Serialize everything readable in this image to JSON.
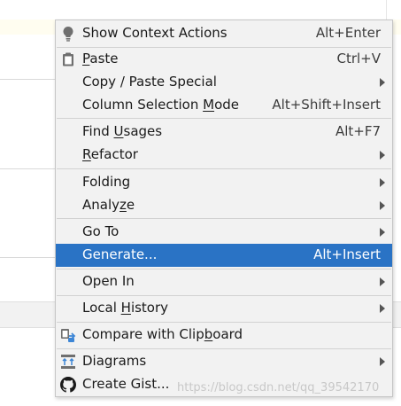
{
  "menu": {
    "items": [
      {
        "name": "show-context-actions",
        "icon": "lightbulb-icon",
        "label": "Show Context Actions",
        "shortcut": "Alt+Enter"
      },
      {
        "name": "paste",
        "icon": "clipboard-icon",
        "label_pre": "",
        "label_u": "P",
        "label_post": "aste",
        "shortcut": "Ctrl+V"
      },
      {
        "name": "copy-paste-special",
        "label": "Copy / Paste Special",
        "submenu": true
      },
      {
        "name": "column-selection-mode",
        "label_pre": "Column Selection ",
        "label_u": "M",
        "label_post": "ode",
        "shortcut": "Alt+Shift+Insert"
      },
      {
        "name": "find-usages",
        "label_pre": "Find ",
        "label_u": "U",
        "label_post": "sages",
        "shortcut": "Alt+F7"
      },
      {
        "name": "refactor",
        "label_pre": "",
        "label_u": "R",
        "label_post": "efactor",
        "submenu": true
      },
      {
        "name": "folding",
        "label": "Folding",
        "submenu": true
      },
      {
        "name": "analyze",
        "label_pre": "Analy",
        "label_u": "z",
        "label_post": "e",
        "submenu": true
      },
      {
        "name": "go-to",
        "label": "Go To",
        "submenu": true
      },
      {
        "name": "generate",
        "label": "Generate...",
        "shortcut": "Alt+Insert",
        "selected": true
      },
      {
        "name": "open-in",
        "label": "Open In",
        "submenu": true
      },
      {
        "name": "local-history",
        "label_pre": "Local ",
        "label_u": "H",
        "label_post": "istory",
        "submenu": true
      },
      {
        "name": "compare-with-clipboard",
        "icon": "compare-icon",
        "label_pre": "Compare with Clip",
        "label_u": "b",
        "label_post": "oard"
      },
      {
        "name": "diagrams",
        "icon": "diagram-icon",
        "label": "Diagrams",
        "submenu": true
      },
      {
        "name": "create-gist",
        "icon": "github-icon",
        "label": "Create Gist..."
      }
    ]
  },
  "watermark": "https://blog.csdn.net/qq_39542170",
  "colors": {
    "selection": "#2a73c5",
    "menu_bg": "#f2f2f2"
  }
}
